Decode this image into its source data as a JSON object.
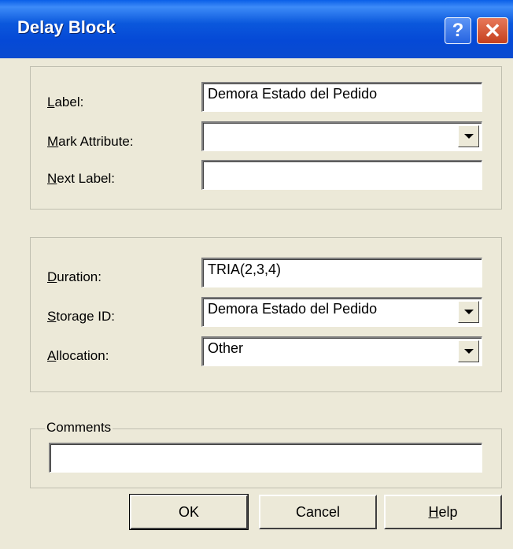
{
  "window": {
    "title": "Delay Block"
  },
  "titlebar": {
    "help_glyph": "?",
    "close_glyph": "✕"
  },
  "group1": {
    "label_label": "Label:",
    "label_value": "Demora Estado del Pedido",
    "mark_attribute_label": "Mark Attribute:",
    "mark_attribute_value": "",
    "next_label_label": "Next Label:",
    "next_label_value": ""
  },
  "group2": {
    "duration_label": "Duration:",
    "duration_value": "TRIA(2,3,4)",
    "storage_id_label": "Storage ID:",
    "storage_id_value": "Demora Estado del Pedido",
    "allocation_label": "Allocation:",
    "allocation_value": "Other"
  },
  "comments": {
    "legend": "Comments",
    "value": ""
  },
  "buttons": {
    "ok": "OK",
    "cancel": "Cancel",
    "help": "Help"
  },
  "icons": {
    "help": "help-icon",
    "close": "close-icon",
    "dropdown": "chevron-down-icon"
  }
}
